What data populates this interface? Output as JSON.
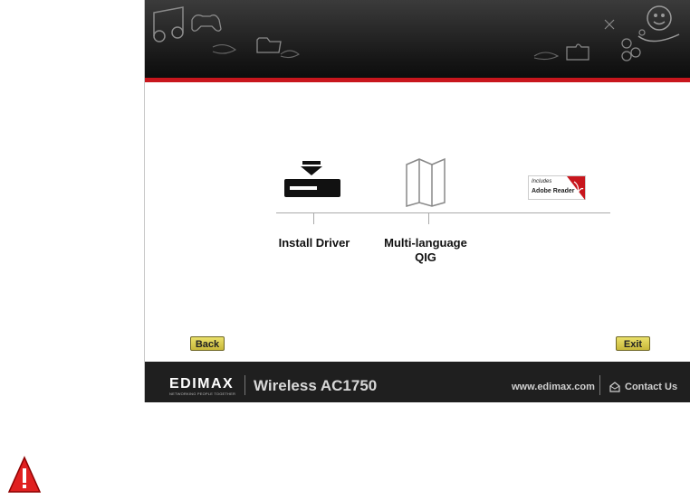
{
  "main": {
    "install_driver_label": "Install Driver",
    "qig_label_line1": "Multi-language",
    "qig_label_line2": "QIG",
    "adobe_includes": "Includes",
    "adobe_name_part1": "Adobe",
    "adobe_name_part2": "Reader"
  },
  "nav": {
    "back_label": "Back",
    "exit_label": "Exit"
  },
  "footer": {
    "brand": "EDIMAX",
    "tagline": "NETWORKING PEOPLE TOGETHER",
    "product": "Wireless AC1750",
    "url": "www.edimax.com",
    "contact": "Contact Us"
  },
  "colors": {
    "accent_red": "#c8161d",
    "button_yellow": "#eae06a",
    "header_dark": "#151515"
  },
  "icons": [
    "music-icon",
    "gamepad-icon",
    "folder-icon",
    "handshake-icon",
    "smiley-hand-icon",
    "puzzle-icon",
    "download-icon",
    "map-icon",
    "adobe-reader-icon",
    "contact-icon",
    "warning-icon"
  ]
}
